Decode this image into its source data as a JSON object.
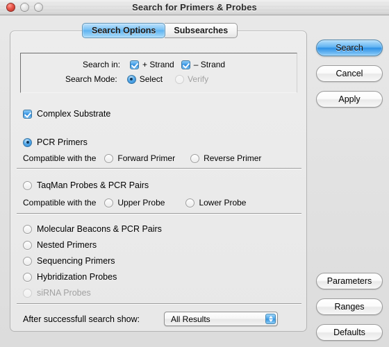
{
  "window": {
    "title": "Search for Primers & Probes",
    "controls": {
      "close": "close-button",
      "minimize": "minimize-button",
      "zoom": "zoom-button"
    }
  },
  "tabs": [
    {
      "label": "Search Options",
      "active": true
    },
    {
      "label": "Subsearches",
      "active": false
    }
  ],
  "groupbox": {
    "search_in_label": "Search in:",
    "plus_strand_label": "+ Strand",
    "plus_strand_checked": true,
    "minus_strand_label": "– Strand",
    "minus_strand_checked": true,
    "search_mode_label": "Search Mode:",
    "select_label": "Select",
    "select_selected": true,
    "verify_label": "Verify",
    "verify_disabled": true
  },
  "complex_substrate": {
    "label": "Complex Substrate",
    "checked": true
  },
  "pcr_primers": {
    "label": "PCR Primers",
    "selected": true,
    "compatible_label": "Compatible with the",
    "forward_label": "Forward Primer",
    "reverse_label": "Reverse Primer"
  },
  "taqman": {
    "label": "TaqMan Probes & PCR Pairs",
    "selected": false,
    "compatible_label": "Compatible with the",
    "upper_label": "Upper Probe",
    "lower_label": "Lower Probe"
  },
  "other_options": [
    {
      "label": "Molecular Beacons & PCR Pairs",
      "selected": false,
      "disabled": false
    },
    {
      "label": "Nested Primers",
      "selected": false,
      "disabled": false
    },
    {
      "label": "Sequencing Primers",
      "selected": false,
      "disabled": false
    },
    {
      "label": "Hybridization Probes",
      "selected": false,
      "disabled": false
    },
    {
      "label": "siRNA Probes",
      "selected": false,
      "disabled": true
    }
  ],
  "after_search": {
    "label": "After successfull search show:",
    "value": "All Results"
  },
  "buttons": {
    "search": "Search",
    "cancel": "Cancel",
    "apply": "Apply",
    "parameters": "Parameters",
    "ranges": "Ranges",
    "defaults": "Defaults"
  },
  "colors": {
    "accent_blue": "#3e9ae6",
    "window_bg": "#e6e6e6",
    "panel_bg": "#ededed",
    "disabled_text": "#a2a2a2"
  }
}
